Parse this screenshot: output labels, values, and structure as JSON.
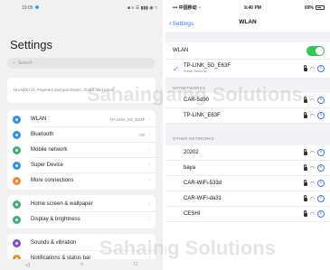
{
  "left": {
    "status": {
      "time": "19:05",
      "icons": "■ ≡ ☰ ▮▮▮ ◉ □"
    },
    "title": "Settings",
    "search_placeholder": "Search",
    "account_text": "HUAWEI ID, Payment and purchases, Cloud, and more",
    "group1": [
      {
        "label": "WLAN",
        "value": "TP-LINK_5G_E63F",
        "icon": "wifi-icon",
        "color": "#2f8ef4"
      },
      {
        "label": "Bluetooth",
        "value": "On",
        "icon": "bluetooth-icon",
        "color": "#2f8ef4"
      },
      {
        "label": "Mobile network",
        "value": "",
        "icon": "mobile-network-icon",
        "color": "#3cb371"
      },
      {
        "label": "Super Device",
        "value": "",
        "icon": "super-device-icon",
        "color": "#2f8ef4"
      },
      {
        "label": "More connections",
        "value": "",
        "icon": "link-icon",
        "color": "#f08a24"
      }
    ],
    "group2": [
      {
        "label": "Home screen & wallpaper",
        "value": "",
        "icon": "home-screen-icon",
        "color": "#3cb371"
      },
      {
        "label": "Display & brightness",
        "value": "",
        "icon": "display-icon",
        "color": "#3cb371"
      }
    ],
    "group3": [
      {
        "label": "Sounds & vibration",
        "value": "",
        "icon": "sound-icon",
        "color": "#7b4fd8"
      },
      {
        "label": "Notifications & status bar",
        "value": "",
        "icon": "notification-icon",
        "color": "#f08a24"
      }
    ],
    "nav": {
      "back": "◁",
      "home": "○",
      "recents": "□"
    }
  },
  "right": {
    "status": {
      "carrier": "••• 中国移动 ◔",
      "time": "6:40 PM",
      "battery": "69%"
    },
    "back_label": "Settings",
    "title": "WLAN",
    "wlan_label": "WLAN",
    "wlan_on": true,
    "connected": {
      "name": "TP-LINK_5G_E63F",
      "sub": "Weak Security"
    },
    "my_networks_header": "MY NETWORKS",
    "my_networks": [
      "CAR-5d90",
      "TP-LINK_E63F"
    ],
    "other_networks_header": "OTHER NETWORKS",
    "other_networks": [
      "20202",
      "baya",
      "CAR-WiFi-533d",
      "CAR-WiFi-da31",
      "CESHI"
    ]
  },
  "colors": {
    "accent_blue": "#2f7cf6",
    "toggle_green": "#34c759"
  }
}
